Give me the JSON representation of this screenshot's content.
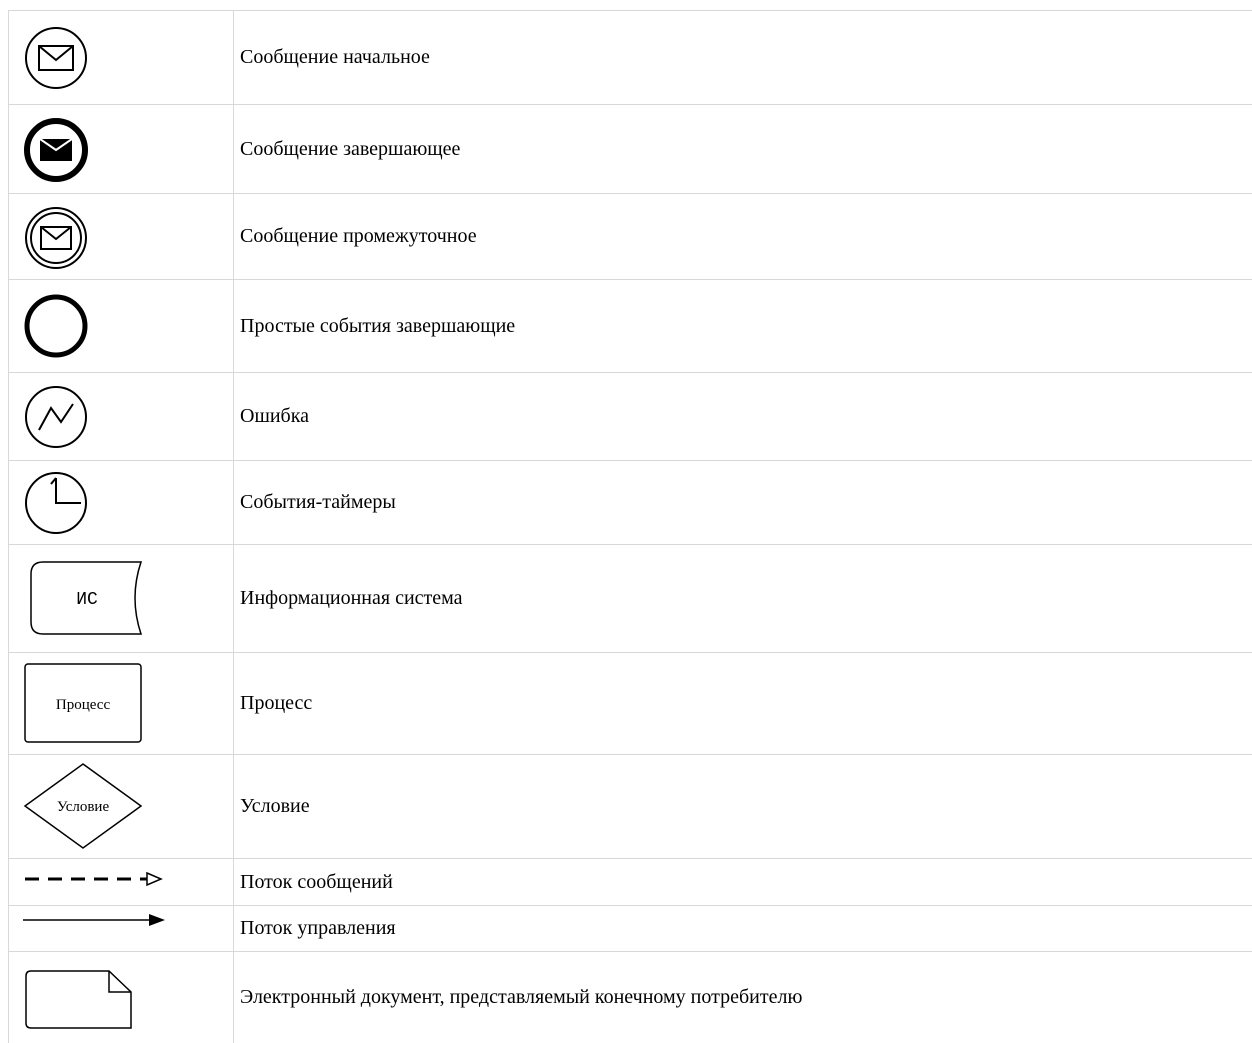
{
  "legend": {
    "rows": [
      {
        "icon": "start-message-event-icon",
        "label": "Сообщение начальное"
      },
      {
        "icon": "end-message-event-icon",
        "label": "Сообщение завершающее"
      },
      {
        "icon": "intermediate-message-event-icon",
        "label": "Сообщение промежуточное"
      },
      {
        "icon": "end-event-icon",
        "label": "Простые события завершающие"
      },
      {
        "icon": "error-event-icon",
        "label": "Ошибка"
      },
      {
        "icon": "timer-event-icon",
        "label": "События-таймеры"
      },
      {
        "icon": "information-system-icon",
        "label": "Информационная система",
        "icon_text": "ИС"
      },
      {
        "icon": "process-icon",
        "label": "Процесс",
        "icon_text": "Процесс"
      },
      {
        "icon": "condition-icon",
        "label": "Условие",
        "icon_text": "Условие"
      },
      {
        "icon": "message-flow-icon",
        "label": "Поток сообщений"
      },
      {
        "icon": "control-flow-icon",
        "label": "Поток управления"
      },
      {
        "icon": "electronic-document-icon",
        "label": "Электронный документ, представляемый конечному потребителю"
      }
    ]
  }
}
